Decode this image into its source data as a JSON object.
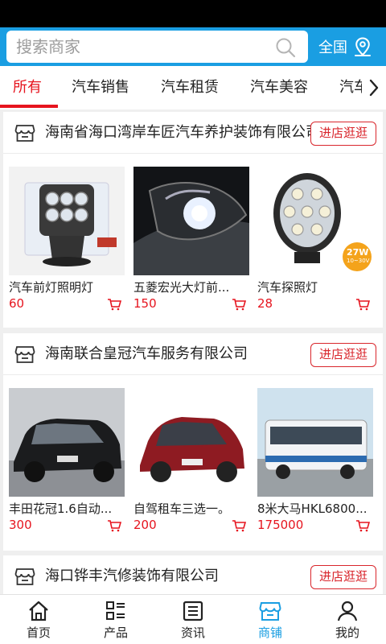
{
  "search": {
    "placeholder": "搜索商家"
  },
  "header": {
    "region_label": "全国"
  },
  "tabs": [
    {
      "label": "所有",
      "active": true
    },
    {
      "label": "汽车销售"
    },
    {
      "label": "汽车租赁"
    },
    {
      "label": "汽车美容"
    },
    {
      "label": "汽车"
    }
  ],
  "stores": [
    {
      "name": "海南省海口湾岸车匠汽车养护装饰有限公司",
      "enter_label": "进店逛逛",
      "products": [
        {
          "title": "汽车前灯照明灯",
          "price": "60"
        },
        {
          "title": "五菱宏光大灯前...",
          "price": "150"
        },
        {
          "title": "汽车探照灯",
          "price": "28",
          "badge": "27W",
          "badge_sub": "10~30V"
        }
      ]
    },
    {
      "name": "海南联合皇冠汽车服务有限公司",
      "enter_label": "进店逛逛",
      "products": [
        {
          "title": "丰田花冠1.6自动...",
          "price": "300"
        },
        {
          "title": "自驾租车三选一。",
          "price": "200"
        },
        {
          "title": "8米大马HKL6800...",
          "price": "175000"
        }
      ]
    },
    {
      "name": "海口铧丰汽修装饰有限公司",
      "enter_label": "进店逛逛"
    }
  ],
  "bottom_nav": [
    {
      "label": "首页",
      "icon": "home-icon"
    },
    {
      "label": "产品",
      "icon": "list-icon"
    },
    {
      "label": "资讯",
      "icon": "news-icon"
    },
    {
      "label": "商铺",
      "icon": "shop-icon",
      "active": true
    },
    {
      "label": "我的",
      "icon": "user-icon"
    }
  ],
  "colors": {
    "header_bg": "#1a9ee2",
    "accent_red": "#e6141e",
    "active_nav": "#1a9ee2"
  }
}
